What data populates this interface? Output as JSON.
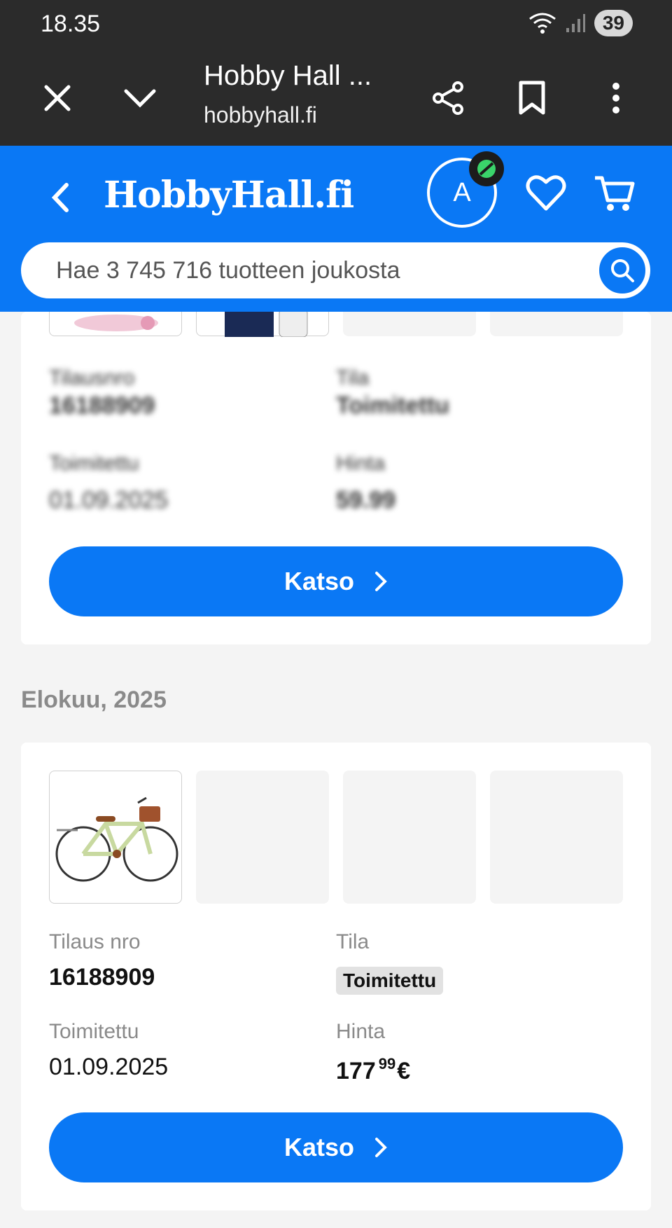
{
  "status_bar": {
    "time": "18.35",
    "battery": "39"
  },
  "browser": {
    "title": "Hobby Hall ...",
    "url": "hobbyhall.fi"
  },
  "header": {
    "logo": "HobbyHall.fi",
    "avatar_initial": "A",
    "search_placeholder": "Hae 3 745 716 tuotteen joukosta",
    "brand_color": "#0a78f5"
  },
  "orders_top": {
    "order_no_label": "Tilausnro",
    "order_no": "16188909",
    "status_label": "Tila",
    "status": "Toimitettu",
    "delivered_label": "Toimitettu",
    "delivered": "01.09.2025",
    "price_label": "Hinta",
    "price": "59.99",
    "button_label": "Katso"
  },
  "month_header": "Elokuu, 2025",
  "order": {
    "order_no_label": "Tilaus nro",
    "order_no": "16188909",
    "status_label": "Tila",
    "status": "Toimitettu",
    "delivered_label": "Toimitettu",
    "delivered": "01.09.2025",
    "price_label": "Hinta",
    "price_int": "177",
    "price_dec": "99",
    "currency": "€",
    "button_label": "Katso"
  }
}
